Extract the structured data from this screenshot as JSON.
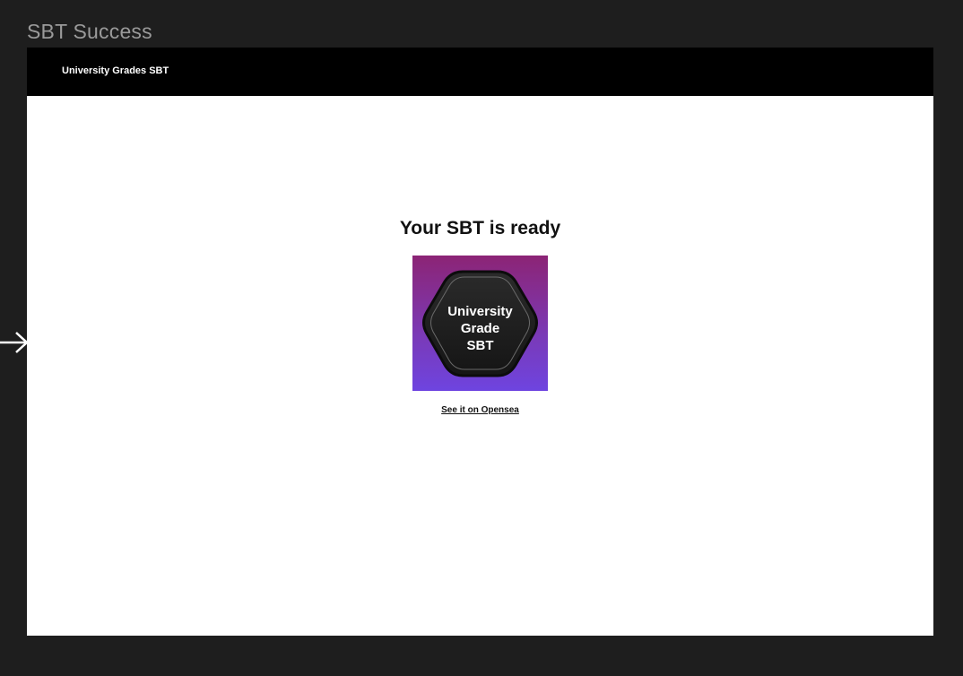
{
  "canvas": {
    "frame_title": "SBT Success",
    "background_color": "#1e1e1e"
  },
  "navbar": {
    "brand": "University Grades SBT",
    "background_color": "#000000"
  },
  "main": {
    "headline": "Your SBT is ready",
    "token": {
      "label_lines": [
        "University",
        "Grade",
        "SBT"
      ],
      "gradient_colors": [
        "#8c2475",
        "#6e44e0"
      ],
      "badge_color": "#1a1a1a",
      "icon": "hexagon-badge-icon"
    },
    "link_text": "See it on Opensea"
  },
  "prototype": {
    "connector_icon": "arrow-right-icon"
  }
}
